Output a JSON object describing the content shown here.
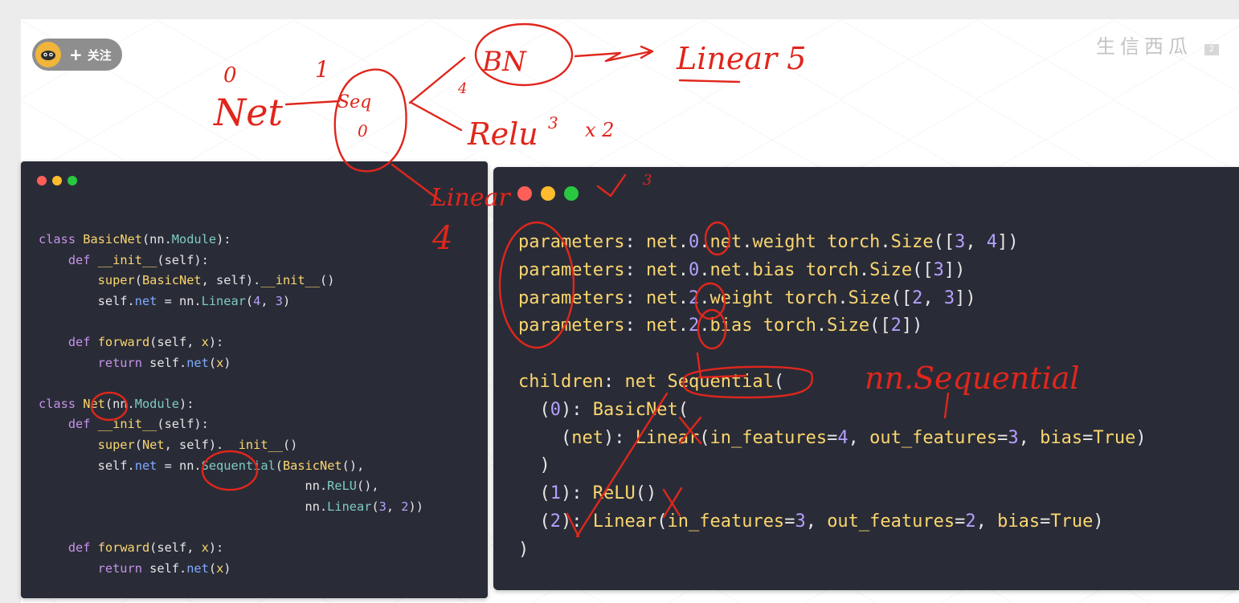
{
  "follow_button": {
    "plus": "+",
    "label": "关注"
  },
  "watermark": {
    "text": "生信西瓜",
    "badge": "2"
  },
  "left_panel": {
    "code_lines": [
      [
        {
          "t": "class ",
          "c": "kw"
        },
        {
          "t": "BasicNet",
          "c": "fn"
        },
        {
          "t": "(nn.",
          "c": "plain"
        },
        {
          "t": "Module",
          "c": "cls"
        },
        {
          "t": "):",
          "c": "plain"
        }
      ],
      [
        {
          "t": "    def ",
          "c": "kw"
        },
        {
          "t": "__init__",
          "c": "fn"
        },
        {
          "t": "(self):",
          "c": "plain"
        }
      ],
      [
        {
          "t": "        super",
          "c": "fn"
        },
        {
          "t": "(",
          "c": "plain"
        },
        {
          "t": "BasicNet",
          "c": "fn"
        },
        {
          "t": ", self).",
          "c": "plain"
        },
        {
          "t": "__init__",
          "c": "fn"
        },
        {
          "t": "()",
          "c": "plain"
        }
      ],
      [
        {
          "t": "        self.",
          "c": "plain"
        },
        {
          "t": "net",
          "c": "attr"
        },
        {
          "t": " = nn.",
          "c": "plain"
        },
        {
          "t": "Linear",
          "c": "cls"
        },
        {
          "t": "(",
          "c": "plain"
        },
        {
          "t": "4",
          "c": "num"
        },
        {
          "t": ", ",
          "c": "plain"
        },
        {
          "t": "3",
          "c": "num"
        },
        {
          "t": ")",
          "c": "plain"
        }
      ],
      [
        {
          "t": "",
          "c": "plain"
        }
      ],
      [
        {
          "t": "    def ",
          "c": "kw"
        },
        {
          "t": "forward",
          "c": "fn"
        },
        {
          "t": "(self, ",
          "c": "plain"
        },
        {
          "t": "x",
          "c": "fn"
        },
        {
          "t": "):",
          "c": "plain"
        }
      ],
      [
        {
          "t": "        return ",
          "c": "kw"
        },
        {
          "t": "self.",
          "c": "plain"
        },
        {
          "t": "net",
          "c": "attr"
        },
        {
          "t": "(",
          "c": "plain"
        },
        {
          "t": "x",
          "c": "fn"
        },
        {
          "t": ")",
          "c": "plain"
        }
      ],
      [
        {
          "t": "",
          "c": "plain"
        }
      ],
      [
        {
          "t": "class ",
          "c": "kw"
        },
        {
          "t": "Net",
          "c": "fn"
        },
        {
          "t": "(nn.",
          "c": "plain"
        },
        {
          "t": "Module",
          "c": "cls"
        },
        {
          "t": "):",
          "c": "plain"
        }
      ],
      [
        {
          "t": "    def ",
          "c": "kw"
        },
        {
          "t": "__init__",
          "c": "fn"
        },
        {
          "t": "(self):",
          "c": "plain"
        }
      ],
      [
        {
          "t": "        super",
          "c": "fn"
        },
        {
          "t": "(",
          "c": "plain"
        },
        {
          "t": "Net",
          "c": "fn"
        },
        {
          "t": ", self).",
          "c": "plain"
        },
        {
          "t": "__init__",
          "c": "fn"
        },
        {
          "t": "()",
          "c": "plain"
        }
      ],
      [
        {
          "t": "        self.",
          "c": "plain"
        },
        {
          "t": "net",
          "c": "attr"
        },
        {
          "t": " = nn.",
          "c": "plain"
        },
        {
          "t": "Sequential",
          "c": "cls"
        },
        {
          "t": "(",
          "c": "plain"
        },
        {
          "t": "BasicNet",
          "c": "fn"
        },
        {
          "t": "(),",
          "c": "plain"
        }
      ],
      [
        {
          "t": "                                    nn.",
          "c": "plain"
        },
        {
          "t": "ReLU",
          "c": "cls"
        },
        {
          "t": "(),",
          "c": "plain"
        }
      ],
      [
        {
          "t": "                                    nn.",
          "c": "plain"
        },
        {
          "t": "Linear",
          "c": "cls"
        },
        {
          "t": "(",
          "c": "plain"
        },
        {
          "t": "3",
          "c": "num"
        },
        {
          "t": ", ",
          "c": "plain"
        },
        {
          "t": "2",
          "c": "num"
        },
        {
          "t": "))",
          "c": "plain"
        }
      ],
      [
        {
          "t": "",
          "c": "plain"
        }
      ],
      [
        {
          "t": "    def ",
          "c": "kw"
        },
        {
          "t": "forward",
          "c": "fn"
        },
        {
          "t": "(self, ",
          "c": "plain"
        },
        {
          "t": "x",
          "c": "fn"
        },
        {
          "t": "):",
          "c": "plain"
        }
      ],
      [
        {
          "t": "        return ",
          "c": "kw"
        },
        {
          "t": "self.",
          "c": "plain"
        },
        {
          "t": "net",
          "c": "attr"
        },
        {
          "t": "(",
          "c": "plain"
        },
        {
          "t": "x",
          "c": "fn"
        },
        {
          "t": ")",
          "c": "plain"
        }
      ]
    ]
  },
  "right_panel": {
    "output_lines": [
      [
        {
          "t": "parameters",
          "c": "fn"
        },
        {
          "t": ": ",
          "c": "plain"
        },
        {
          "t": "net",
          "c": "fn"
        },
        {
          "t": ".",
          "c": "plain"
        },
        {
          "t": "0",
          "c": "num"
        },
        {
          "t": ".",
          "c": "plain"
        },
        {
          "t": "net",
          "c": "fn"
        },
        {
          "t": ".",
          "c": "plain"
        },
        {
          "t": "weight",
          "c": "fn"
        },
        {
          "t": " ",
          "c": "plain"
        },
        {
          "t": "torch",
          "c": "fn"
        },
        {
          "t": ".",
          "c": "plain"
        },
        {
          "t": "Size",
          "c": "fn"
        },
        {
          "t": "([",
          "c": "plain"
        },
        {
          "t": "3",
          "c": "num"
        },
        {
          "t": ", ",
          "c": "plain"
        },
        {
          "t": "4",
          "c": "num"
        },
        {
          "t": "])",
          "c": "plain"
        }
      ],
      [
        {
          "t": "parameters",
          "c": "fn"
        },
        {
          "t": ": ",
          "c": "plain"
        },
        {
          "t": "net",
          "c": "fn"
        },
        {
          "t": ".",
          "c": "plain"
        },
        {
          "t": "0",
          "c": "num"
        },
        {
          "t": ".",
          "c": "plain"
        },
        {
          "t": "net",
          "c": "fn"
        },
        {
          "t": ".",
          "c": "plain"
        },
        {
          "t": "bias",
          "c": "fn"
        },
        {
          "t": " ",
          "c": "plain"
        },
        {
          "t": "torch",
          "c": "fn"
        },
        {
          "t": ".",
          "c": "plain"
        },
        {
          "t": "Size",
          "c": "fn"
        },
        {
          "t": "([",
          "c": "plain"
        },
        {
          "t": "3",
          "c": "num"
        },
        {
          "t": "])",
          "c": "plain"
        }
      ],
      [
        {
          "t": "parameters",
          "c": "fn"
        },
        {
          "t": ": ",
          "c": "plain"
        },
        {
          "t": "net",
          "c": "fn"
        },
        {
          "t": ".",
          "c": "plain"
        },
        {
          "t": "2",
          "c": "num"
        },
        {
          "t": ".",
          "c": "plain"
        },
        {
          "t": "weight",
          "c": "fn"
        },
        {
          "t": " ",
          "c": "plain"
        },
        {
          "t": "torch",
          "c": "fn"
        },
        {
          "t": ".",
          "c": "plain"
        },
        {
          "t": "Size",
          "c": "fn"
        },
        {
          "t": "([",
          "c": "plain"
        },
        {
          "t": "2",
          "c": "num"
        },
        {
          "t": ", ",
          "c": "plain"
        },
        {
          "t": "3",
          "c": "num"
        },
        {
          "t": "])",
          "c": "plain"
        }
      ],
      [
        {
          "t": "parameters",
          "c": "fn"
        },
        {
          "t": ": ",
          "c": "plain"
        },
        {
          "t": "net",
          "c": "fn"
        },
        {
          "t": ".",
          "c": "plain"
        },
        {
          "t": "2",
          "c": "num"
        },
        {
          "t": ".",
          "c": "plain"
        },
        {
          "t": "bias",
          "c": "fn"
        },
        {
          "t": " ",
          "c": "plain"
        },
        {
          "t": "torch",
          "c": "fn"
        },
        {
          "t": ".",
          "c": "plain"
        },
        {
          "t": "Size",
          "c": "fn"
        },
        {
          "t": "([",
          "c": "plain"
        },
        {
          "t": "2",
          "c": "num"
        },
        {
          "t": "])",
          "c": "plain"
        }
      ],
      [
        {
          "t": "",
          "c": "plain"
        }
      ],
      [
        {
          "t": "children",
          "c": "fn"
        },
        {
          "t": ": ",
          "c": "plain"
        },
        {
          "t": "net",
          "c": "fn"
        },
        {
          "t": " ",
          "c": "plain"
        },
        {
          "t": "Sequential",
          "c": "fn"
        },
        {
          "t": "(",
          "c": "plain"
        }
      ],
      [
        {
          "t": "  (",
          "c": "plain"
        },
        {
          "t": "0",
          "c": "num"
        },
        {
          "t": "): ",
          "c": "plain"
        },
        {
          "t": "BasicNet",
          "c": "fn"
        },
        {
          "t": "(",
          "c": "plain"
        }
      ],
      [
        {
          "t": "    (",
          "c": "plain"
        },
        {
          "t": "net",
          "c": "fn"
        },
        {
          "t": "): ",
          "c": "plain"
        },
        {
          "t": "Linear",
          "c": "fn"
        },
        {
          "t": "(",
          "c": "plain"
        },
        {
          "t": "in_features",
          "c": "fn"
        },
        {
          "t": "=",
          "c": "plain"
        },
        {
          "t": "4",
          "c": "num"
        },
        {
          "t": ", ",
          "c": "plain"
        },
        {
          "t": "out_features",
          "c": "fn"
        },
        {
          "t": "=",
          "c": "plain"
        },
        {
          "t": "3",
          "c": "num"
        },
        {
          "t": ", ",
          "c": "plain"
        },
        {
          "t": "bias",
          "c": "fn"
        },
        {
          "t": "=",
          "c": "plain"
        },
        {
          "t": "True",
          "c": "bool"
        },
        {
          "t": ")",
          "c": "plain"
        }
      ],
      [
        {
          "t": "  )",
          "c": "plain"
        }
      ],
      [
        {
          "t": "  (",
          "c": "plain"
        },
        {
          "t": "1",
          "c": "num"
        },
        {
          "t": "): ",
          "c": "plain"
        },
        {
          "t": "ReLU",
          "c": "fn"
        },
        {
          "t": "()",
          "c": "plain"
        }
      ],
      [
        {
          "t": "  (",
          "c": "plain"
        },
        {
          "t": "2",
          "c": "num"
        },
        {
          "t": "): ",
          "c": "plain"
        },
        {
          "t": "Linear",
          "c": "fn"
        },
        {
          "t": "(",
          "c": "plain"
        },
        {
          "t": "in_features",
          "c": "fn"
        },
        {
          "t": "=",
          "c": "plain"
        },
        {
          "t": "3",
          "c": "num"
        },
        {
          "t": ", ",
          "c": "plain"
        },
        {
          "t": "out_features",
          "c": "fn"
        },
        {
          "t": "=",
          "c": "plain"
        },
        {
          "t": "2",
          "c": "num"
        },
        {
          "t": ", ",
          "c": "plain"
        },
        {
          "t": "bias",
          "c": "fn"
        },
        {
          "t": "=",
          "c": "plain"
        },
        {
          "t": "True",
          "c": "bool"
        },
        {
          "t": ")",
          "c": "plain"
        }
      ],
      [
        {
          "t": ")",
          "c": "plain"
        }
      ]
    ]
  },
  "annotations": {
    "texts": [
      "0",
      "1",
      "Net",
      "Seq",
      "0",
      "BN",
      "Linear 5",
      "Relu",
      "3",
      "x 2",
      "4",
      "Linear",
      "4",
      "3",
      "nn.Sequential"
    ]
  },
  "colors": {
    "panel_bg": "#292c37",
    "ink": "#e0261c",
    "button_bg": "#8e8e8e",
    "avatar": "#f0b53a"
  }
}
